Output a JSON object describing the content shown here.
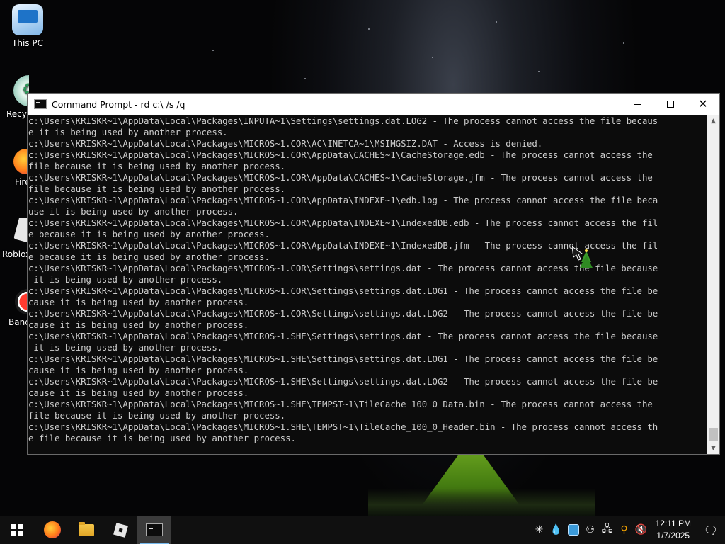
{
  "desktop": {
    "icons": [
      {
        "label": "This PC"
      },
      {
        "label": "Recyc"
      },
      {
        "label": "Firef"
      },
      {
        "label": "Robloxe"
      },
      {
        "label": "Band"
      }
    ]
  },
  "cmd_window": {
    "title": "Command Prompt - rd  c:\\ /s /q",
    "controls": {
      "minimize": "minimize",
      "maximize": "maximize",
      "close": "close"
    },
    "output_lines": [
      "c:\\Users\\KRISKR~1\\AppData\\Local\\Packages\\INPUTA~1\\Settings\\settings.dat.LOG2 - The process cannot access the file becaus",
      "e it is being used by another process.",
      "c:\\Users\\KRISKR~1\\AppData\\Local\\Packages\\MICROS~1.COR\\AC\\INETCA~1\\MSIMGSIZ.DAT - Access is denied.",
      "c:\\Users\\KRISKR~1\\AppData\\Local\\Packages\\MICROS~1.COR\\AppData\\CACHES~1\\CacheStorage.edb - The process cannot access the",
      "file because it is being used by another process.",
      "c:\\Users\\KRISKR~1\\AppData\\Local\\Packages\\MICROS~1.COR\\AppData\\CACHES~1\\CacheStorage.jfm - The process cannot access the",
      "file because it is being used by another process.",
      "c:\\Users\\KRISKR~1\\AppData\\Local\\Packages\\MICROS~1.COR\\AppData\\INDEXE~1\\edb.log - The process cannot access the file beca",
      "use it is being used by another process.",
      "c:\\Users\\KRISKR~1\\AppData\\Local\\Packages\\MICROS~1.COR\\AppData\\INDEXE~1\\IndexedDB.edb - The process cannot access the fil",
      "e because it is being used by another process.",
      "c:\\Users\\KRISKR~1\\AppData\\Local\\Packages\\MICROS~1.COR\\AppData\\INDEXE~1\\IndexedDB.jfm - The process cannot access the fil",
      "e because it is being used by another process.",
      "c:\\Users\\KRISKR~1\\AppData\\Local\\Packages\\MICROS~1.COR\\Settings\\settings.dat - The process cannot access the file because",
      " it is being used by another process.",
      "c:\\Users\\KRISKR~1\\AppData\\Local\\Packages\\MICROS~1.COR\\Settings\\settings.dat.LOG1 - The process cannot access the file be",
      "cause it is being used by another process.",
      "c:\\Users\\KRISKR~1\\AppData\\Local\\Packages\\MICROS~1.COR\\Settings\\settings.dat.LOG2 - The process cannot access the file be",
      "cause it is being used by another process.",
      "c:\\Users\\KRISKR~1\\AppData\\Local\\Packages\\MICROS~1.SHE\\Settings\\settings.dat - The process cannot access the file because",
      " it is being used by another process.",
      "c:\\Users\\KRISKR~1\\AppData\\Local\\Packages\\MICROS~1.SHE\\Settings\\settings.dat.LOG1 - The process cannot access the file be",
      "cause it is being used by another process.",
      "c:\\Users\\KRISKR~1\\AppData\\Local\\Packages\\MICROS~1.SHE\\Settings\\settings.dat.LOG2 - The process cannot access the file be",
      "cause it is being used by another process.",
      "c:\\Users\\KRISKR~1\\AppData\\Local\\Packages\\MICROS~1.SHE\\TEMPST~1\\TileCache_100_0_Data.bin - The process cannot access the",
      "file because it is being used by another process.",
      "c:\\Users\\KRISKR~1\\AppData\\Local\\Packages\\MICROS~1.SHE\\TEMPST~1\\TileCache_100_0_Header.bin - The process cannot access th",
      "e file because it is being used by another process."
    ],
    "colors": {
      "background": "#0c0c0c",
      "text": "#cccccc"
    }
  },
  "taskbar": {
    "pinned": [
      {
        "name": "start-button",
        "icon": "windows-logo-icon"
      },
      {
        "name": "firefox",
        "icon": "firefox-icon"
      },
      {
        "name": "file-explorer",
        "icon": "folder-icon"
      },
      {
        "name": "roblox",
        "icon": "roblox-icon"
      },
      {
        "name": "command-prompt",
        "icon": "cmd-icon",
        "active": true
      }
    ],
    "tray": {
      "icons": [
        "snowflake-icon",
        "droplet-icon",
        "app-icon",
        "network-user-icon",
        "network-icon",
        "search-icon",
        "volume-muted-icon"
      ],
      "time": "12:11 PM",
      "date": "1/7/2025"
    }
  }
}
